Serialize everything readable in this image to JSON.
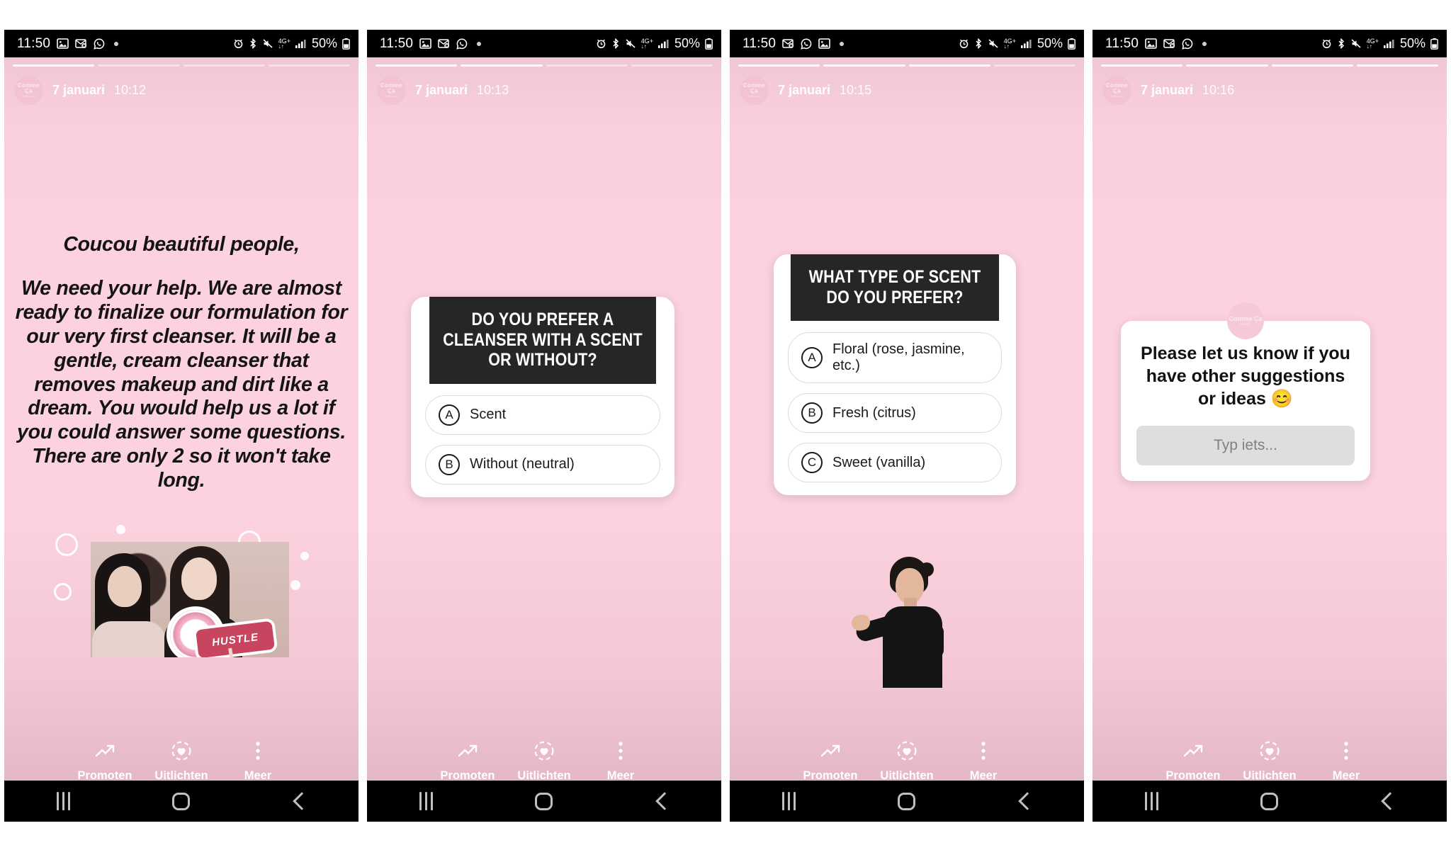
{
  "status_bar": {
    "time": "11:50",
    "battery": "50%",
    "network": "4G+",
    "left_icons": [
      "photos-icon",
      "outlook-icon",
      "whatsapp-icon",
      "dot-icon"
    ],
    "right_icons": [
      "alarm-icon",
      "bluetooth-icon",
      "mute-icon",
      "network-icon",
      "signal-icon",
      "battery-icon"
    ]
  },
  "nav_bar": {
    "recent_label": "Recente apps",
    "home_label": "Start",
    "back_label": "Terug"
  },
  "actions": {
    "promote_label": "Promoten",
    "highlight_label": "Uitlichten",
    "more_label": "Meer"
  },
  "account": {
    "avatar_line1": "Comme Ça",
    "avatar_line2": "skincare"
  },
  "panels": [
    {
      "date": "7 januari",
      "time": "10:12",
      "progress_total": 4,
      "progress_active": 0,
      "type": "text",
      "heading": "Coucou beautiful people,",
      "body": "We need your help. We are almost ready to finalize our formulation for our very first cleanser. It will be a gentle, cream cleanser that removes makeup and dirt like a dream. You would help us a lot if you could answer some questions. There are only 2 so it won't take long.",
      "photo_alt": "two women holding a cleanser prop and a sign"
    },
    {
      "date": "7 januari",
      "time": "10:13",
      "progress_total": 4,
      "progress_active": 1,
      "type": "quiz",
      "quiz_title": "Do you prefer a cleanser with a scent or without?",
      "options": [
        {
          "letter": "A",
          "label": "Scent"
        },
        {
          "letter": "B",
          "label": "Without (neutral)"
        }
      ]
    },
    {
      "date": "7 januari",
      "time": "10:15",
      "progress_total": 4,
      "progress_active": 2,
      "type": "quiz",
      "quiz_title": "What type of scent do you prefer?",
      "options": [
        {
          "letter": "A",
          "label": "Floral (rose, jasmine, etc.)"
        },
        {
          "letter": "B",
          "label": "Fresh (citrus)"
        },
        {
          "letter": "C",
          "label": "Sweet (vanilla)"
        }
      ],
      "photo_alt": "woman gesturing toward the quiz"
    },
    {
      "date": "7 januari",
      "time": "10:16",
      "progress_total": 4,
      "progress_active": 3,
      "type": "question",
      "question_text": "Please let us know if you have other suggestions or ideas 😊",
      "answer_placeholder": "Typ iets..."
    }
  ],
  "colors": {
    "story_background": "#fbd2de",
    "sticker_header": "#262626",
    "sticker_body": "#ffffff",
    "system_bar": "#000000",
    "input_fill": "#dedede"
  }
}
